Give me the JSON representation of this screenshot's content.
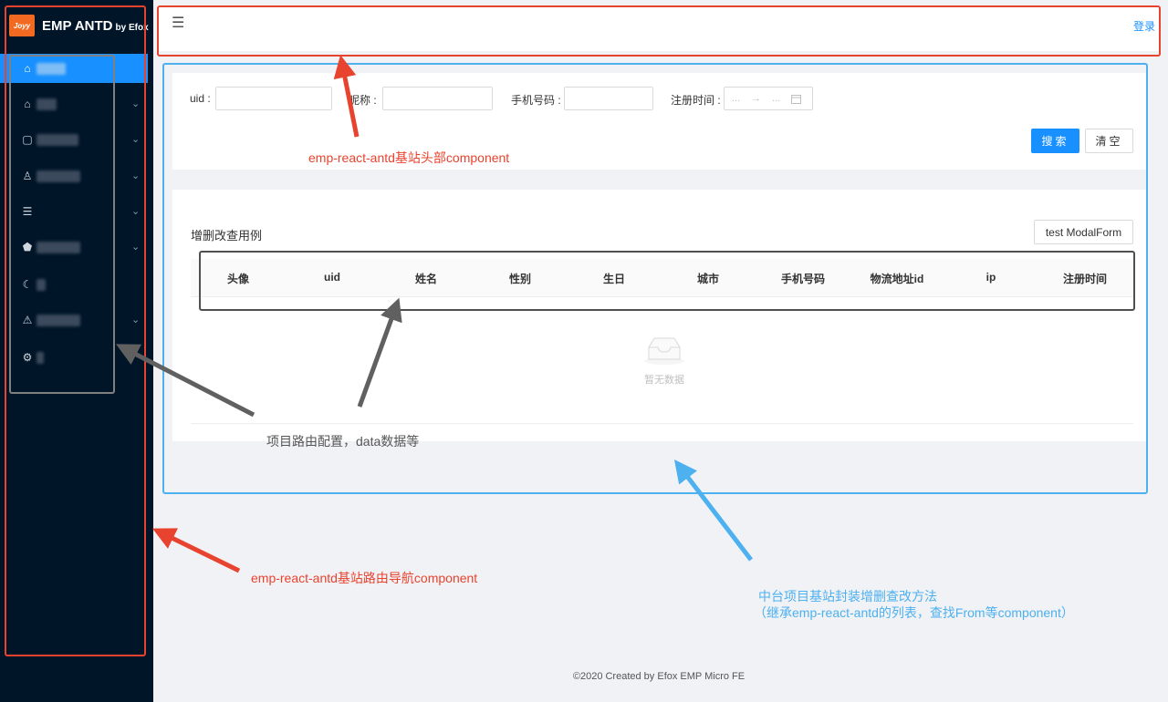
{
  "app": {
    "logo_text": "Joyy",
    "title": "EMP ANTD",
    "title_by": "by Efox"
  },
  "sidebar": {
    "items": [
      {
        "icon": "home-icon",
        "active": true,
        "has_children": false
      },
      {
        "icon": "bank-icon",
        "active": false,
        "has_children": true
      },
      {
        "icon": "form-icon",
        "active": false,
        "has_children": true
      },
      {
        "icon": "user-icon",
        "active": false,
        "has_children": true
      },
      {
        "icon": "ordered-list-icon",
        "active": false,
        "has_children": true
      },
      {
        "icon": "pentagon-icon",
        "active": false,
        "has_children": true
      },
      {
        "icon": "moon-icon",
        "active": false,
        "has_children": false
      },
      {
        "icon": "warning-icon",
        "active": false,
        "has_children": true
      },
      {
        "icon": "settings-icon",
        "active": false,
        "has_children": false
      }
    ]
  },
  "header": {
    "login_label": "登录"
  },
  "search": {
    "uid_label": "uid :",
    "nickname_label": "昵称 :",
    "phone_label": "手机号码 :",
    "register_time_label": "注册时间 :",
    "range_start_placeholder": "...",
    "range_separator": "→",
    "range_end_placeholder": "...",
    "search_button": "搜索",
    "clear_button": "清空"
  },
  "table": {
    "title": "增删改查用例",
    "modal_button": "test ModalForm",
    "columns": [
      "头像",
      "uid",
      "姓名",
      "性别",
      "生日",
      "城市",
      "手机号码",
      "物流地址id",
      "ip",
      "注册时间"
    ],
    "empty_text": "暂无数据"
  },
  "footer": {
    "text": "©2020 Created by Efox EMP Micro FE"
  },
  "annotations": {
    "header_note": "emp-react-antd基站头部component",
    "routes_note": "项目路由配置，data数据等",
    "nav_note": "emp-react-antd基站路由导航component",
    "crud_note_line1": "中台项目基站封装增删查改方法",
    "crud_note_line2": "（继承emp-react-antd的列表，查找From等component）"
  },
  "colors": {
    "sidebar_bg": "#011529",
    "primary": "#1890ff",
    "annotation_red": "#e8432f",
    "annotation_blue": "#4db0ef",
    "annotation_gray": "#606060"
  }
}
